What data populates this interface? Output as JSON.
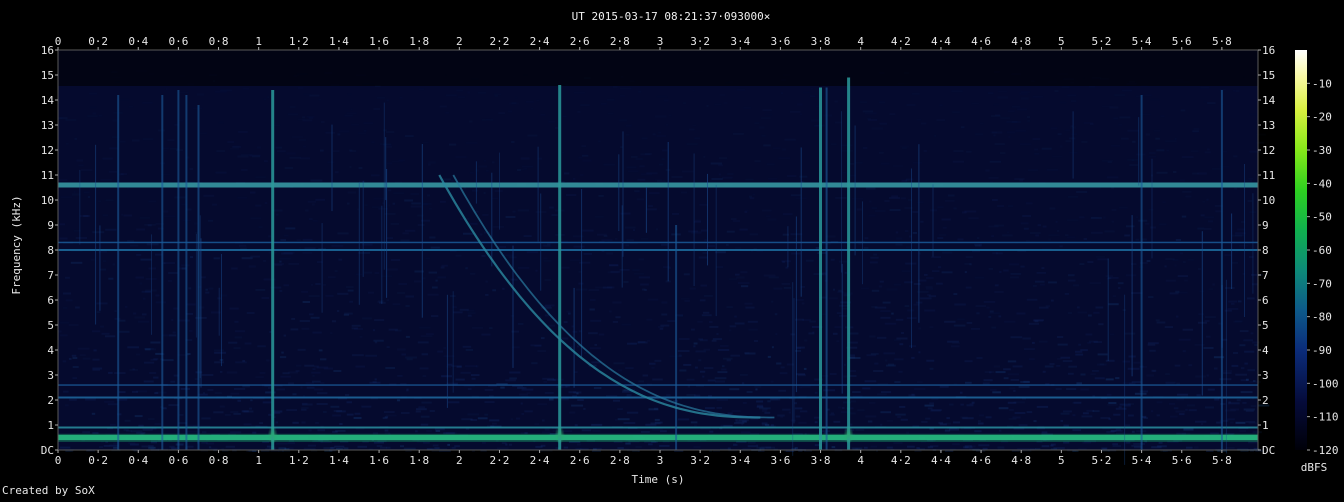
{
  "chart_data": {
    "type": "heatmap",
    "title": "UT 2015-03-17 08:21:37·093000×",
    "xlabel": "Time (s)",
    "ylabel": "Frequency (kHz)",
    "xlim": [
      0,
      5.98
    ],
    "ylim": [
      0,
      16
    ],
    "x_ticks": [
      "0",
      "0·2",
      "0·4",
      "0·6",
      "0·8",
      "1",
      "1·2",
      "1·4",
      "1·6",
      "1·8",
      "2",
      "2·2",
      "2·4",
      "2·6",
      "2·8",
      "3",
      "3·2",
      "3·4",
      "3·6",
      "3·8",
      "4",
      "4·2",
      "4·4",
      "4·6",
      "4·8",
      "5",
      "5·2",
      "5·4",
      "5·6",
      "5·8"
    ],
    "y_ticks": [
      "DC",
      "1",
      "2",
      "3",
      "4",
      "5",
      "6",
      "7",
      "8",
      "9",
      "10",
      "11",
      "12",
      "13",
      "14",
      "15",
      "16"
    ],
    "colorbar": {
      "label": "dBFS",
      "ticks": [
        "-10",
        "-20",
        "-30",
        "-40",
        "-50",
        "-60",
        "-70",
        "-80",
        "-90",
        "-100",
        "-110",
        "-120"
      ],
      "range": [
        -120,
        0
      ]
    },
    "features": {
      "horizontal_bands_khz": [
        0.5,
        0.9,
        2.1,
        2.6,
        8.0,
        8.3,
        10.6
      ],
      "impulses_s": [
        0.3,
        0.52,
        0.6,
        0.64,
        0.7,
        1.07,
        2.5,
        3.08,
        3.8,
        3.83,
        3.94,
        5.4,
        5.8
      ],
      "sweep": {
        "start_s": 1.9,
        "end_s": 3.5,
        "start_khz": 11,
        "end_khz": 1.3
      }
    }
  },
  "footer": {
    "credit": "Created by SoX"
  }
}
